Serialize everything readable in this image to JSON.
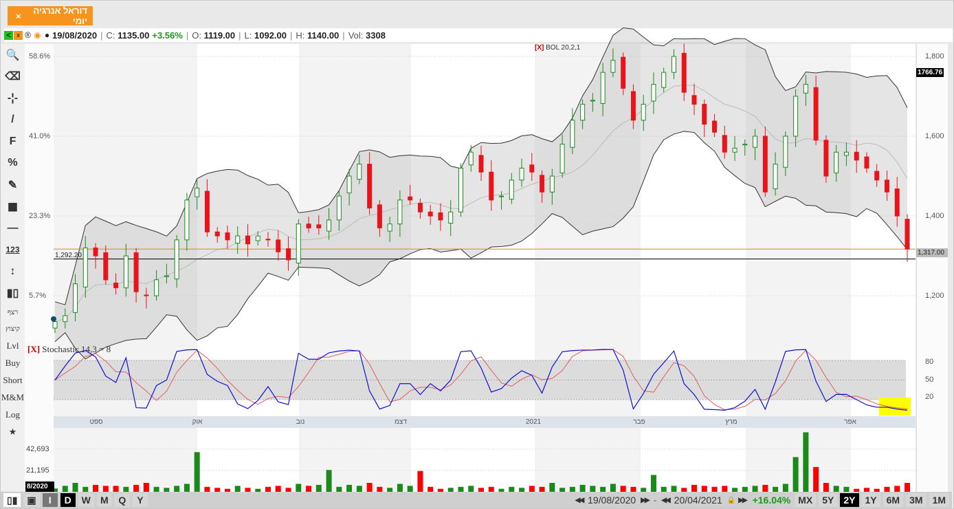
{
  "tab": {
    "title": "דוראל אנרגיה יומי",
    "close": "×"
  },
  "info": {
    "date": "19/08/2020",
    "c_label": "C:",
    "close": "1135.00",
    "change": "+3.56%",
    "o_label": "O:",
    "open": "1119.00",
    "l_label": "L:",
    "low": "1092.00",
    "h_label": "H:",
    "high": "1140.00",
    "vol_label": "Vol:",
    "vol": "3308"
  },
  "toolbar": {
    "items": [
      {
        "name": "zoom-tool",
        "glyph": "🔍"
      },
      {
        "name": "eraser-tool",
        "glyph": "⌫"
      },
      {
        "name": "crosshair-tool",
        "glyph": "-¦-"
      },
      {
        "name": "line-tool",
        "glyph": "/"
      },
      {
        "name": "fibonacci-tool",
        "glyph": "F"
      },
      {
        "name": "percent-tool",
        "glyph": "%"
      },
      {
        "name": "edit-tool",
        "glyph": "✎"
      },
      {
        "name": "color-tool",
        "glyph": "■"
      },
      {
        "name": "line-width-tool",
        "glyph": "—"
      },
      {
        "name": "measure-tool",
        "glyph": "123"
      },
      {
        "name": "vertical-measure-tool",
        "glyph": "↕"
      },
      {
        "name": "candle-type-tool",
        "glyph": "▮▯"
      }
    ],
    "text_items": [
      "רצף",
      "קיצוץ",
      "Lvl",
      "Buy",
      "Short",
      "M&M",
      "Log",
      "★"
    ]
  },
  "axes": {
    "percent_labels": [
      "58.6%",
      "41.0%",
      "23.3%",
      "5.7%"
    ],
    "price_labels": [
      "1,800",
      "1,600",
      "1,400",
      "1,200"
    ],
    "last_high": "1766.76",
    "current": "1,317.00",
    "hline_label": "1,292.20",
    "stoch_labels": [
      "80",
      "50",
      "20"
    ],
    "volume_labels": [
      "42,693",
      "21,195"
    ],
    "start_date": "8/2020"
  },
  "indicators": {
    "bol_x": "[X]",
    "bol": "BOL 20,2,1",
    "stoch_x": "[X]",
    "stoch": "Stochastic 14,3 = 8"
  },
  "months": [
    "ספט",
    "אוק",
    "נוב",
    "דצמ",
    "2021",
    "פבר",
    "מרץ",
    "אפר"
  ],
  "bottom": {
    "periods": [
      "I",
      "D",
      "W",
      "M",
      "Q",
      "Y"
    ],
    "active_period": "D",
    "from": "19/08/2020",
    "to": "20/04/2021",
    "change": "+16.04%",
    "ranges": [
      "MX",
      "5Y",
      "2Y",
      "1Y",
      "6M",
      "3M",
      "1M"
    ],
    "active_range": "2Y"
  },
  "colors": {
    "up": "#1a8a1a",
    "down": "#e8141b",
    "accent": "#f7941d",
    "stoch_k": "#1010d0",
    "stoch_d": "#e06060",
    "highlight": "#ffff00"
  },
  "chart_data": {
    "type": "candlestick",
    "close": [
      1135,
      1150,
      1230,
      1320,
      1300,
      1240,
      1220,
      1300,
      1210,
      1200,
      1240,
      1250,
      1340,
      1440,
      1470,
      1360,
      1350,
      1340,
      1350,
      1330,
      1350,
      1340,
      1310,
      1290,
      1380,
      1370,
      1370,
      1390,
      1450,
      1500,
      1530,
      1420,
      1370,
      1380,
      1440,
      1440,
      1410,
      1400,
      1390,
      1410,
      1520,
      1560,
      1510,
      1440,
      1450,
      1490,
      1520,
      1510,
      1460,
      1500,
      1580,
      1640,
      1680,
      1690,
      1760,
      1790,
      1720,
      1640,
      1680,
      1730,
      1760,
      1800,
      1710,
      1680,
      1630,
      1610,
      1560,
      1570,
      1580,
      1600,
      1460,
      1530,
      1600,
      1700,
      1730,
      1590,
      1500,
      1560,
      1560,
      1540,
      1520,
      1490,
      1460,
      1400,
      1317
    ],
    "volume": [
      3308,
      6000,
      9000,
      5000,
      7000,
      6000,
      6000,
      5000,
      7000,
      9000,
      5000,
      4000,
      6000,
      8000,
      40000,
      5000,
      4000,
      3000,
      6000,
      4000,
      3000,
      5000,
      6000,
      4000,
      8000,
      6000,
      7000,
      22000,
      5000,
      7000,
      6000,
      9000,
      5000,
      4000,
      8000,
      6000,
      21000,
      5000,
      3000,
      4000,
      5000,
      6000,
      4000,
      5000,
      3000,
      5000,
      4000,
      6000,
      5000,
      9000,
      4000,
      5000,
      7000,
      6000,
      5000,
      8000,
      6000,
      5000,
      4000,
      17000,
      5000,
      6000,
      4000,
      7000,
      6000,
      5000,
      6000,
      4000,
      5000,
      6000,
      7000,
      5000,
      8000,
      35000,
      60000,
      25000,
      9000,
      6000,
      5000,
      3000,
      4000,
      3000,
      5000,
      6000,
      9000
    ],
    "ylim": [
      1100,
      1830
    ],
    "hlines": [
      1317,
      1292.2
    ]
  }
}
